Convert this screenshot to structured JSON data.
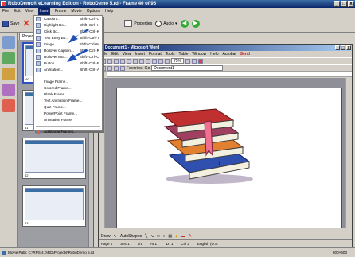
{
  "app": {
    "title": "RoboDemo® eLearning Edition - RoboDemo 5.rd - Frame 40 of 96"
  },
  "menubar": [
    "File",
    "Edit",
    "View",
    "Insert",
    "Frame",
    "Movie",
    "Options",
    "Help"
  ],
  "toolbar": {
    "save": "Save",
    "properties": "Properties",
    "audio": "Audio"
  },
  "panel": {
    "tab": "Projects"
  },
  "insert_menu": {
    "items": [
      {
        "label": "Caption...",
        "shortcut": "Shift+Ctrl+C"
      },
      {
        "label": "Highlight Bo...",
        "shortcut": "Shift+Ctrl+H"
      },
      {
        "label": "Click Bo...",
        "shortcut": "Shift+Ctrl+K"
      },
      {
        "label": "Text Entry Bo...",
        "shortcut": "Shift+Ctrl+T"
      },
      {
        "label": "Image...",
        "shortcut": "Shift+Ctrl+M"
      },
      {
        "label": "Rollover Caption...",
        "shortcut": "Shift+Ctrl+R"
      },
      {
        "label": "Rollover Ima...",
        "shortcut": "Shift+Ctrl+O"
      },
      {
        "label": "Button...",
        "shortcut": "Shift+Ctrl+B"
      },
      {
        "label": "Animation...",
        "shortcut": "Shift+Ctrl+A"
      }
    ],
    "frame_items": [
      "Image Frame...",
      "Colored Frame...",
      "Blank Frame",
      "Text Animation Frame...",
      "Quiz Frame...",
      "PowerPoint Frame...",
      "Animation Frame"
    ],
    "additional": "Additional Frames..."
  },
  "word": {
    "title": "Document1 - Microsoft Word",
    "menu": [
      "File",
      "Edit",
      "View",
      "Insert",
      "Format",
      "Tools",
      "Table",
      "Window",
      "Help",
      "Acrobat",
      "Send"
    ],
    "zoom": "75%",
    "address": "Document1",
    "favorites": "Favorites",
    "go": "Go",
    "draw": "Draw",
    "autoshapes": "AutoShapes",
    "status": [
      "Page 1",
      "Sec 1",
      "1/1",
      "At 1\"",
      "Ln 1",
      "Col 2",
      "English (U.S."
    ]
  },
  "frames": [
    {
      "label": "40"
    },
    {
      "label": "41"
    },
    {
      "label": "42"
    },
    {
      "label": "43"
    }
  ],
  "status": {
    "left": "Movie Path: C:\\RPS 4.0\\RD\\Projects\\RoboDemo 5.rd",
    "right": "800×600"
  }
}
